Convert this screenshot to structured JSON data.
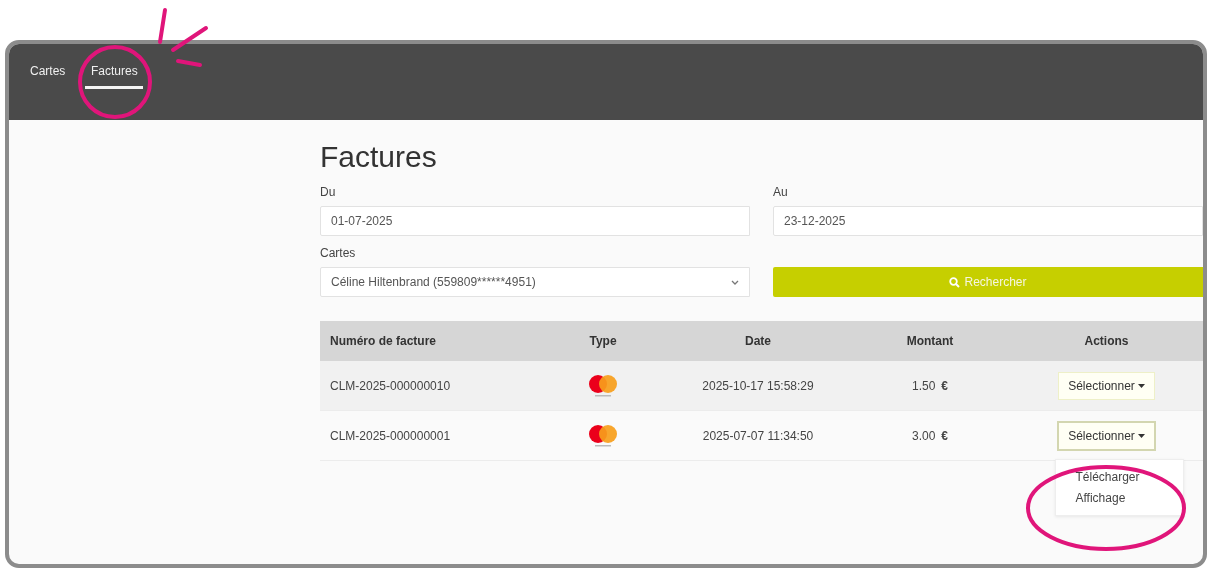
{
  "nav": {
    "tabs": [
      {
        "label": "Cartes",
        "selected": false
      },
      {
        "label": "Factures",
        "selected": true
      }
    ]
  },
  "title": "Factures",
  "filters": {
    "from": {
      "label": "Du",
      "value": "01-07-2025"
    },
    "to": {
      "label": "Au",
      "value": "23-12-2025"
    },
    "card": {
      "label": "Cartes",
      "value": "Céline Hiltenbrand (559809******4951)"
    },
    "search_button": "Rechercher"
  },
  "table": {
    "columns": [
      "Numéro de facture",
      "Type",
      "Date",
      "Montant",
      "Actions"
    ],
    "rows": [
      {
        "number": "CLM-2025-000000010",
        "kind": "mastercard",
        "date": "2025-10-17 15:58:29",
        "amount": "1.50",
        "currency": "€",
        "action": "Sélectionner",
        "menu_open": false
      },
      {
        "number": "CLM-2025-000000001",
        "kind": "mastercard",
        "date": "2025-07-07 11:34:50",
        "amount": "3.00",
        "currency": "€",
        "action": "Sélectionner",
        "menu_open": true
      }
    ],
    "action_menu": [
      "Télécharger",
      "Affichage"
    ]
  }
}
